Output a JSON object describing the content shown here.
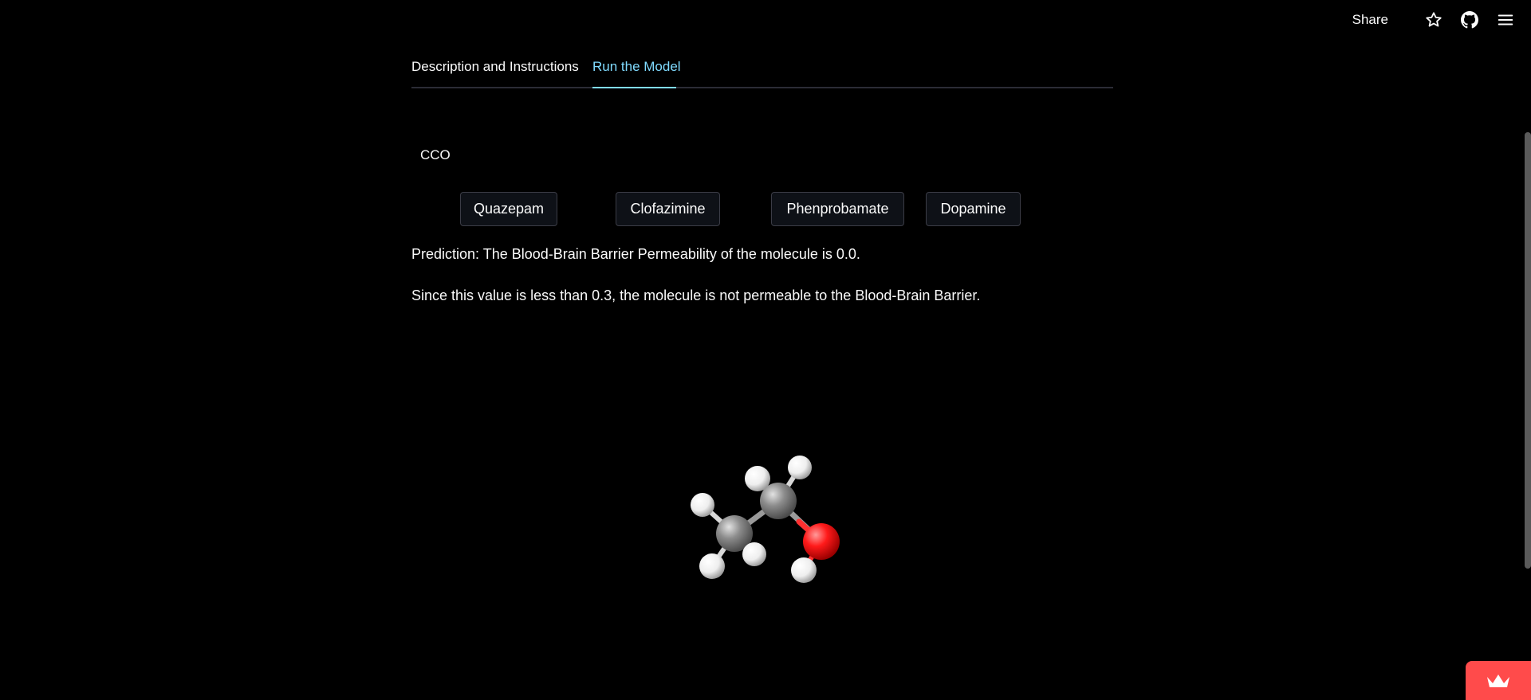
{
  "header": {
    "share_label": "Share",
    "icons": [
      "star-icon",
      "github-icon",
      "hamburger-menu-icon"
    ]
  },
  "tabs": [
    {
      "label": "Description and Instructions",
      "active": false
    },
    {
      "label": "Run the Model",
      "active": true
    }
  ],
  "input": {
    "value": "CCO"
  },
  "buttons": [
    {
      "label": "Quazepam"
    },
    {
      "label": "Clofazimine"
    },
    {
      "label": "Phenprobamate"
    },
    {
      "label": "Dopamine"
    }
  ],
  "result": {
    "prediction": "Prediction: The Blood-Brain Barrier Permeability of the molecule is 0.0.",
    "explanation": "Since this value is less than 0.3, the molecule is not permeable to the Blood-Brain Barrier."
  },
  "molecule_view": {
    "atoms": [
      "C",
      "C",
      "O",
      "H",
      "H",
      "H",
      "H",
      "H",
      "H"
    ]
  },
  "colors": {
    "background": "#000000",
    "text": "#fafafa",
    "accent": "#80dbff",
    "badge": "#ff4b4b",
    "carbon": "#8c8c8c",
    "oxygen": "#ff1a1a",
    "hydrogen": "#ffffff"
  }
}
